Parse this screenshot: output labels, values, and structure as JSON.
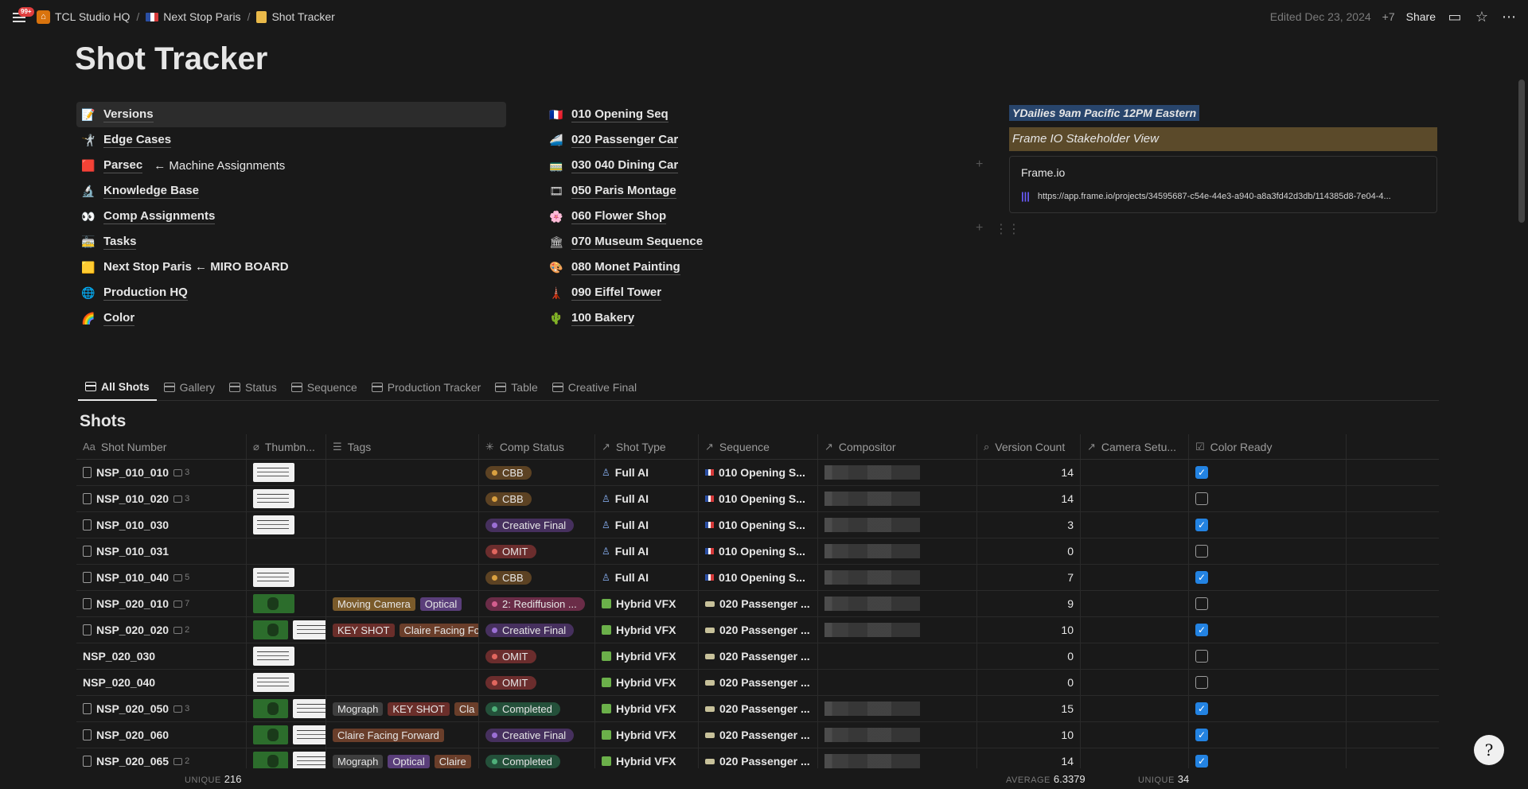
{
  "breadcrumb": {
    "badge": "99+",
    "items": [
      "TCL Studio HQ",
      "Next Stop Paris",
      "Shot Tracker"
    ]
  },
  "topbar": {
    "edited": "Edited Dec 23, 2024",
    "collaborators": "+7",
    "share_label": "Share"
  },
  "page": {
    "title": "Shot Tracker"
  },
  "links_left": [
    {
      "emoji": "📝",
      "text": "Versions",
      "extra": ""
    },
    {
      "emoji": "🤺",
      "text": "Edge Cases",
      "extra": ""
    },
    {
      "emoji": "🟥",
      "text": "Parsec",
      "extra": "← Machine Assignments"
    },
    {
      "emoji": "🔬",
      "text": "Knowledge Base",
      "extra": ""
    },
    {
      "emoji": "👀",
      "text": "Comp Assignments",
      "extra": ""
    },
    {
      "emoji": "🚋",
      "text": "Tasks",
      "extra": ""
    },
    {
      "emoji": "🟨",
      "text": "Next Stop Paris ← MIRO BOARD",
      "extra": ""
    },
    {
      "emoji": "🌐",
      "text": "Production HQ",
      "extra": ""
    },
    {
      "emoji": "🌈",
      "text": "Color",
      "extra": ""
    }
  ],
  "links_mid": [
    {
      "emoji": "🇫🇷",
      "text": "010 Opening Seq"
    },
    {
      "emoji": "🚄",
      "text": "020 Passenger Car"
    },
    {
      "emoji": "🚃",
      "text": "030 040 Dining Car"
    },
    {
      "emoji": "🎞",
      "text": "050 Paris Montage"
    },
    {
      "emoji": "🌸",
      "text": "060 Flower Shop"
    },
    {
      "emoji": "🏛",
      "text": "070 Museum Sequence"
    },
    {
      "emoji": "🎨",
      "text": "080 Monet Painting"
    },
    {
      "emoji": "🗼",
      "text": "090 Eiffel Tower"
    },
    {
      "emoji": "🌵",
      "text": "100 Bakery"
    }
  ],
  "right_panel": {
    "dailies": "YDailies 9am Pacific 12PM Eastern",
    "frameio_heading": "Frame IO Stakeholder View",
    "bookmark_title": "Frame.io",
    "bookmark_url": "https://app.frame.io/projects/34595687-c54e-44e3-a940-a8a3fd42d3db/114385d8-7e04-4..."
  },
  "tabs": [
    "All Shots",
    "Gallery",
    "Status",
    "Sequence",
    "Production Tracker",
    "Table",
    "Creative Final"
  ],
  "database_title": "Shots",
  "columns": [
    "Shot Number",
    "Thumbn...",
    "Tags",
    "Comp Status",
    "Shot Type",
    "Sequence",
    "Compositor",
    "Version Count",
    "Camera Setu...",
    "Color Ready"
  ],
  "rows": [
    {
      "shot": "NSP_010_010",
      "doc": true,
      "comments": "3",
      "thumbs": [
        "white"
      ],
      "tags": [],
      "status": "CBB",
      "type": "Full AI",
      "seq": "010 Opening S...",
      "seq_kind": "flag",
      "count": "14",
      "ready": true
    },
    {
      "shot": "NSP_010_020",
      "doc": true,
      "comments": "3",
      "thumbs": [
        "white"
      ],
      "tags": [],
      "status": "CBB",
      "type": "Full AI",
      "seq": "010 Opening S...",
      "seq_kind": "flag",
      "count": "14",
      "ready": false
    },
    {
      "shot": "NSP_010_030",
      "doc": true,
      "comments": "",
      "thumbs": [
        "white"
      ],
      "tags": [],
      "status": "Creative Final",
      "type": "Full AI",
      "seq": "010 Opening S...",
      "seq_kind": "flag",
      "count": "3",
      "ready": true
    },
    {
      "shot": "NSP_010_031",
      "doc": true,
      "comments": "",
      "thumbs": [],
      "tags": [],
      "status": "OMIT",
      "type": "Full AI",
      "seq": "010 Opening S...",
      "seq_kind": "flag",
      "count": "0",
      "ready": false
    },
    {
      "shot": "NSP_010_040",
      "doc": true,
      "comments": "5",
      "thumbs": [
        "white"
      ],
      "tags": [],
      "status": "CBB",
      "type": "Full AI",
      "seq": "010 Opening S...",
      "seq_kind": "flag",
      "count": "7",
      "ready": true
    },
    {
      "shot": "NSP_020_010",
      "doc": true,
      "comments": "7",
      "thumbs": [
        "green"
      ],
      "tags": [
        "Moving Camera",
        "Optical"
      ],
      "status": "2: Rediffusion ...",
      "type": "Hybrid VFX",
      "seq": "020 Passenger ...",
      "seq_kind": "train",
      "count": "9",
      "ready": false
    },
    {
      "shot": "NSP_020_020",
      "doc": true,
      "comments": "2",
      "thumbs": [
        "green",
        "white"
      ],
      "tags": [
        "KEY SHOT",
        "Claire Facing Fo"
      ],
      "status": "Creative Final",
      "type": "Hybrid VFX",
      "seq": "020 Passenger ...",
      "seq_kind": "train",
      "count": "10",
      "ready": true
    },
    {
      "shot": "NSP_020_030",
      "doc": false,
      "comments": "",
      "thumbs": [
        "white"
      ],
      "tags": [],
      "status": "OMIT",
      "type": "Hybrid VFX",
      "seq": "020 Passenger ...",
      "seq_kind": "train",
      "count": "0",
      "ready": false
    },
    {
      "shot": "NSP_020_040",
      "doc": false,
      "comments": "",
      "thumbs": [
        "white"
      ],
      "tags": [],
      "status": "OMIT",
      "type": "Hybrid VFX",
      "seq": "020 Passenger ...",
      "seq_kind": "train",
      "count": "0",
      "ready": false
    },
    {
      "shot": "NSP_020_050",
      "doc": true,
      "comments": "3",
      "thumbs": [
        "green",
        "white"
      ],
      "tags": [
        "Mograph",
        "KEY SHOT",
        "Cla"
      ],
      "status": "Completed",
      "type": "Hybrid VFX",
      "seq": "020 Passenger ...",
      "seq_kind": "train",
      "count": "15",
      "ready": true
    },
    {
      "shot": "NSP_020_060",
      "doc": true,
      "comments": "",
      "thumbs": [
        "green",
        "white"
      ],
      "tags": [
        "Claire Facing Forward"
      ],
      "status": "Creative Final",
      "type": "Hybrid VFX",
      "seq": "020 Passenger ...",
      "seq_kind": "train",
      "count": "10",
      "ready": true
    },
    {
      "shot": "NSP_020_065",
      "doc": true,
      "comments": "2",
      "thumbs": [
        "green",
        "white"
      ],
      "tags": [
        "Mograph",
        "Optical",
        "Claire"
      ],
      "status": "Completed",
      "type": "Hybrid VFX",
      "seq": "020 Passenger ...",
      "seq_kind": "train",
      "count": "14",
      "ready": true
    }
  ],
  "tag_colors": {
    "Moving Camera": "#7a5a2a",
    "Optical": "#5a3e7a",
    "KEY SHOT": "#6a2e2a",
    "Claire Facing Fo": "#6a3e2a",
    "Claire Facing Forward": "#6a3e2a",
    "Mograph": "#3e3e3e",
    "Cla": "#6a3e2a",
    "Claire": "#6a3e2a"
  },
  "status_colors": {
    "CBB": {
      "bg": "#5c4223",
      "dot": "#d9a040"
    },
    "Creative Final": {
      "bg": "#46305e",
      "dot": "#9b6fd4"
    },
    "OMIT": {
      "bg": "#6b2d2d",
      "dot": "#e0665e"
    },
    "2: Rediffusion ...": {
      "bg": "#6a2c47",
      "dot": "#d45e8e"
    },
    "Completed": {
      "bg": "#24503a",
      "dot": "#4fb07a"
    }
  },
  "footer": {
    "unique_label_1": "UNIQUE",
    "unique_value_1": "216",
    "average_label": "AVERAGE",
    "average_value": "6.3379",
    "unique_label_2": "UNIQUE",
    "unique_value_2": "34"
  }
}
